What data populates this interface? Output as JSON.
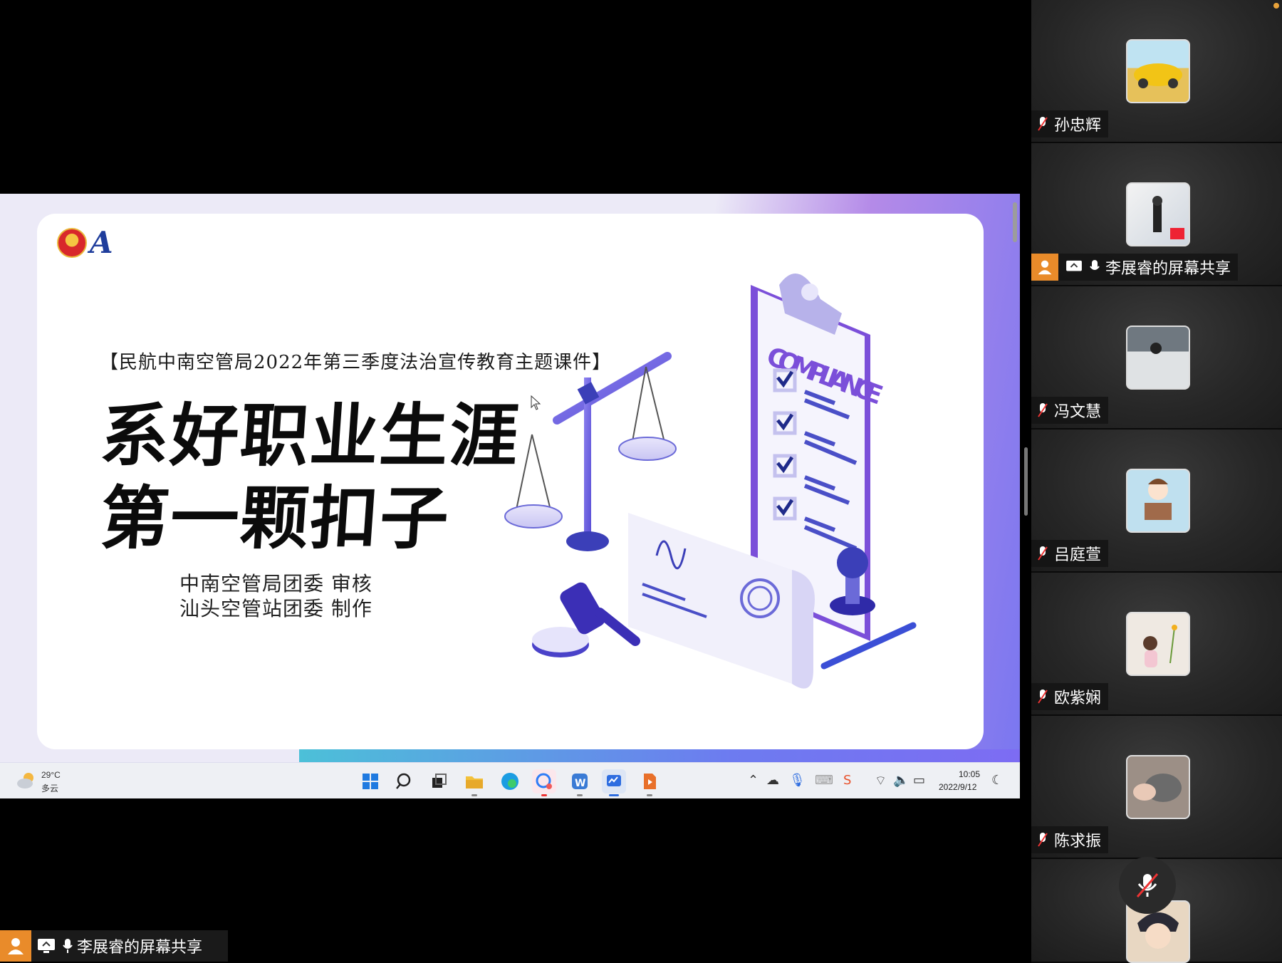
{
  "slide": {
    "subtitle": "【民航中南空管局2022年第三季度法治宣传教育主题课件】",
    "title_line_1": "系好职业生涯",
    "title_line_2": "第一颗扣子",
    "credit_line_1": "中南空管局团委  审核",
    "credit_line_2": "汕头空管站团委  制作",
    "illustration_label": "COMPLIANCE"
  },
  "taskbar": {
    "weather_temp": "29°C",
    "weather_desc": "多云",
    "clock_time": "10:05",
    "clock_date": "2022/9/12",
    "pinned_icons": [
      "start-icon",
      "search-icon",
      "task-view-icon",
      "file-explorer-icon",
      "edge-icon",
      "meeting-app-icon",
      "wps-icon",
      "whiteboard-icon",
      "presentation-icon"
    ]
  },
  "main_tag": {
    "label": "李展睿的屏幕共享"
  },
  "participants": [
    {
      "name": "孙忠辉",
      "muted": true
    },
    {
      "name": "李展睿的屏幕共享",
      "sharing": true
    },
    {
      "name": "冯文慧",
      "muted": true
    },
    {
      "name": "吕庭萱",
      "muted": true
    },
    {
      "name": "欧紫娴",
      "muted": true
    },
    {
      "name": "陈求振",
      "muted": true
    }
  ],
  "colors": {
    "accent_orange": "#e98b2a",
    "slide_purple": "#7a77f0",
    "slide_cyan": "#4cc0d8"
  }
}
